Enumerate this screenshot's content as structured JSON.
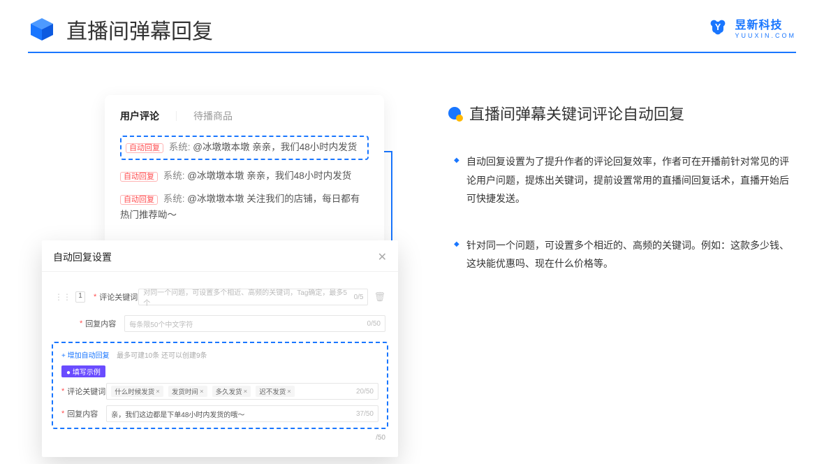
{
  "header": {
    "title": "直播间弹幕回复"
  },
  "brand": {
    "name_cn": "昱新科技",
    "name_en": "YUUXIN.COM"
  },
  "comments": {
    "tab_active": "用户评论",
    "tab_inactive": "待播商品",
    "auto_tag": "自动回复",
    "system_label": " 系统: ",
    "row1": "@冰墩墩本墩 亲亲，我们48小时内发货",
    "row2": "@冰墩墩本墩 亲亲，我们48小时内发货",
    "row3": "@冰墩墩本墩 关注我们的店铺，每日都有热门推荐呦～"
  },
  "dialog": {
    "title": "自动回复设置",
    "idx": "1",
    "keyword_label": "评论关键词",
    "keyword_placeholder": "对同一个问题，可设置多个相近、高频的关键词，Tag确定，最多5个",
    "keyword_counter": "0/5",
    "content_label": "回复内容",
    "content_placeholder": "每条限50个中文字符",
    "content_counter": "0/50",
    "add_link": "+ 增加自动回复",
    "add_hint": "最多可建10条 还可以创建9条",
    "example_badge": "● 填写示例",
    "ex_kw_label": "评论关键词",
    "ex_tags": [
      "什么时候发货",
      "发货时间",
      "多久发货",
      "迟不发货"
    ],
    "ex_kw_counter": "20/50",
    "ex_content_label": "回复内容",
    "ex_content_value": "亲，我们这边都是下单48小时内发货的哦～",
    "ex_content_counter": "37/50",
    "outer_counter": "/50"
  },
  "right": {
    "section_title": "直播间弹幕关键词评论自动回复",
    "para1": "自动回复设置为了提升作者的评论回复效率，作者可在开播前针对常见的评论用户问题，提炼出关键词，提前设置常用的直播间回复话术，直播开始后可快捷发送。",
    "para2": "针对同一个问题，可设置多个相近的、高频的关键词。例如：这款多少钱、这块能优惠吗、现在什么价格等。"
  }
}
